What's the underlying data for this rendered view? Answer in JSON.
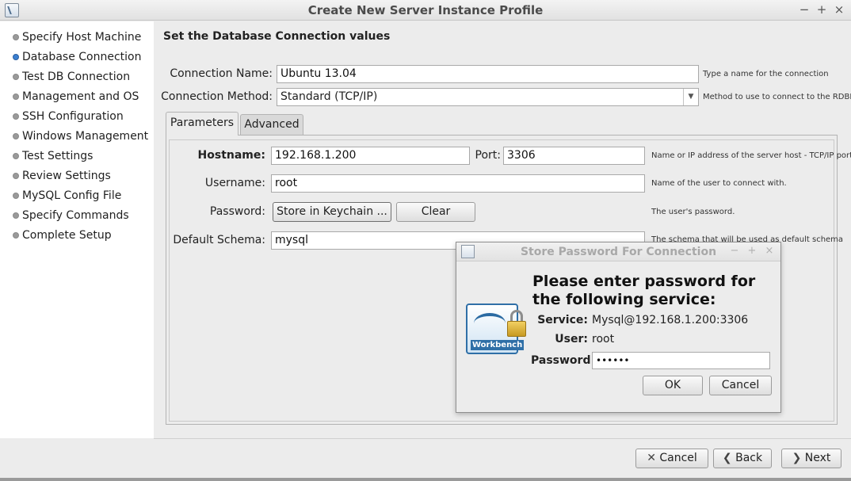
{
  "window": {
    "title": "Create New Server Instance Profile",
    "controls": {
      "minimize": "−",
      "maximize": "+",
      "close": "×"
    }
  },
  "sidebar": {
    "items": [
      {
        "label": "Specify Host Machine",
        "active": false
      },
      {
        "label": "Database Connection",
        "active": true
      },
      {
        "label": "Test DB Connection",
        "active": false
      },
      {
        "label": "Management and OS",
        "active": false
      },
      {
        "label": "SSH Configuration",
        "active": false
      },
      {
        "label": "Windows Management",
        "active": false
      },
      {
        "label": "Test Settings",
        "active": false
      },
      {
        "label": "Review Settings",
        "active": false
      },
      {
        "label": "MySQL Config File",
        "active": false
      },
      {
        "label": "Specify Commands",
        "active": false
      },
      {
        "label": "Complete Setup",
        "active": false
      }
    ]
  },
  "main": {
    "section_title": "Set the Database Connection values",
    "connection_name": {
      "label": "Connection Name:",
      "value": "Ubuntu 13.04",
      "hint": "Type a name for the connection"
    },
    "connection_method": {
      "label": "Connection Method:",
      "value": "Standard (TCP/IP)",
      "hint": "Method to use to connect to the RDBMS"
    },
    "tabs": [
      {
        "label": "Parameters",
        "selected": true
      },
      {
        "label": "Advanced",
        "selected": false
      }
    ],
    "hostname": {
      "label": "Hostname:",
      "value": "192.168.1.200"
    },
    "port": {
      "label": "Port:",
      "value": "3306",
      "hint": "Name or IP address of the server host - TCP/IP port"
    },
    "username": {
      "label": "Username:",
      "value": "root",
      "hint": "Name of the user to connect with."
    },
    "password": {
      "label": "Password:",
      "store_label": "Store in Keychain ...",
      "clear_label": "Clear",
      "hint": "The user's password."
    },
    "default_schema": {
      "label": "Default Schema:",
      "value": "mysql",
      "hint": "The schema that will be used as default schema"
    }
  },
  "footer": {
    "cancel_label": "Cancel",
    "back_label": "Back",
    "next_label": "Next"
  },
  "dialog": {
    "title": "Store Password For Connection",
    "controls": {
      "minimize": "−",
      "maximize": "+",
      "close": "×"
    },
    "heading": "Please enter password for the following service:",
    "service_label": "Service:",
    "service_value": "Mysql@192.168.1.200:3306",
    "user_label": "User:",
    "user_value": "root",
    "password_label": "Password:",
    "password_value": "••••••",
    "logo_text": "Workbench",
    "ok_label": "OK",
    "cancel_label": "Cancel"
  },
  "icons": {
    "app": "mysql-workbench-icon",
    "lock": "padlock-icon",
    "cancel": "x-mark-icon",
    "back": "chevron-left-icon",
    "next": "chevron-right-icon"
  },
  "colors": {
    "active_step": "#3b7fd1",
    "sidebar_bg": "#ffffff",
    "window_bg": "#ececec"
  }
}
